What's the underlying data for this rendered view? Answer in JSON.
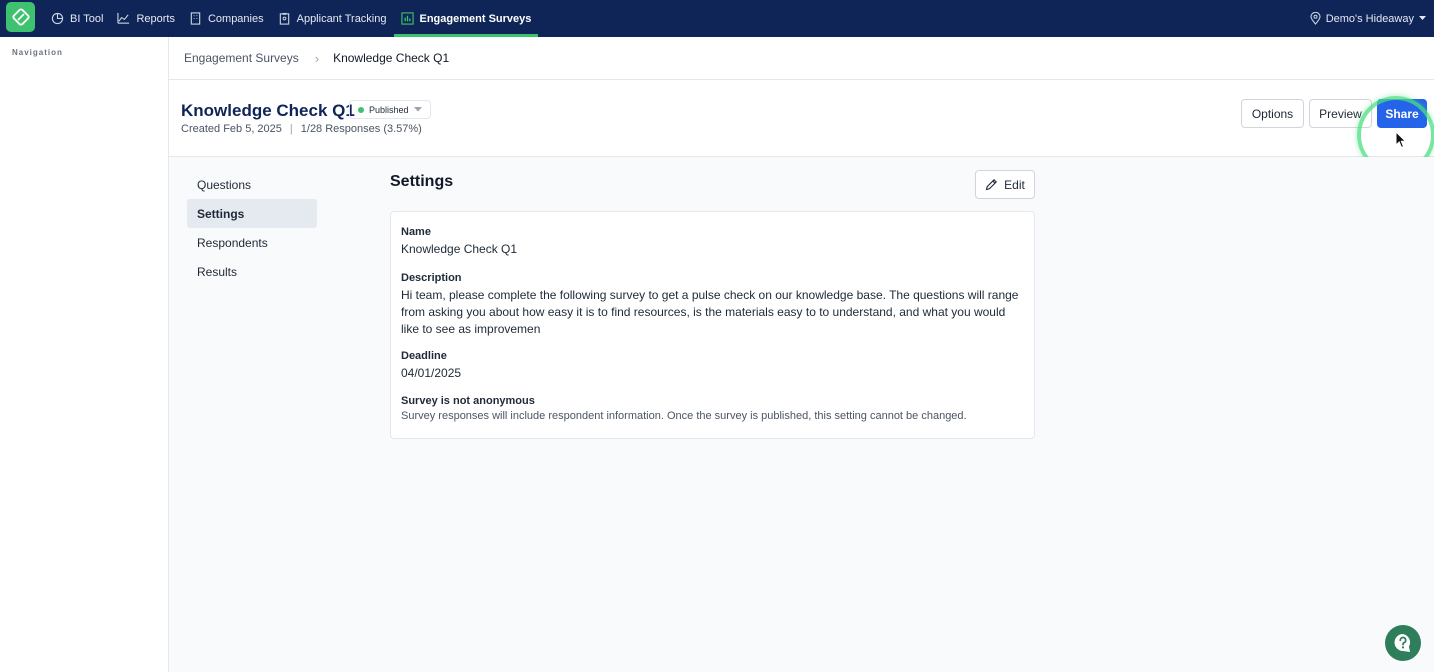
{
  "topnav": {
    "items": [
      {
        "label": "BI Tool",
        "icon": "chart-pie-icon"
      },
      {
        "label": "Reports",
        "icon": "line-chart-icon"
      },
      {
        "label": "Companies",
        "icon": "building-icon"
      },
      {
        "label": "Applicant Tracking",
        "icon": "clipboard-icon"
      },
      {
        "label": "Engagement Surveys",
        "icon": "bar-chart-icon"
      }
    ],
    "active": "Engagement Surveys",
    "location": "Demo's Hideaway"
  },
  "leftnav": {
    "title": "Navigation"
  },
  "breadcrumb": {
    "parent": "Engagement Surveys",
    "current": "Knowledge Check Q1"
  },
  "header": {
    "title": "Knowledge Check Q1",
    "status": "Published",
    "created": "Created Feb 5, 2025",
    "responses": "1/28 Responses (3.57%)",
    "options_label": "Options",
    "preview_label": "Preview",
    "share_label": "Share"
  },
  "subnav": {
    "items": [
      "Questions",
      "Settings",
      "Respondents",
      "Results"
    ],
    "active": "Settings"
  },
  "settings": {
    "title": "Settings",
    "edit_label": "Edit",
    "name_label": "Name",
    "name_value": "Knowledge Check Q1",
    "description_label": "Description",
    "description_value": "Hi team, please complete the following survey to get a pulse check on our knowledge base. The questions will range from asking you about how easy it is to find resources, is the materials easy to to understand, and what you would like to see as improvemen",
    "deadline_label": "Deadline",
    "deadline_value": "04/01/2025",
    "anonymous_label": "Survey is not anonymous",
    "anonymous_desc": "Survey responses will include respondent information. Once the survey is published, this setting cannot be changed."
  },
  "colors": {
    "navy": "#0f2557",
    "accent_green": "#3fc26f",
    "primary_blue": "#2563eb",
    "help_green": "#2e7d5b"
  }
}
